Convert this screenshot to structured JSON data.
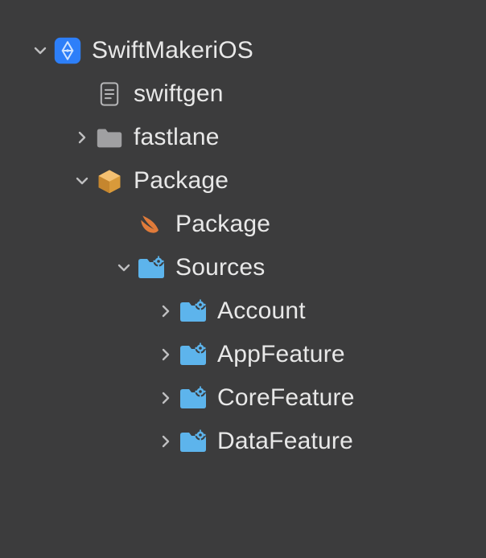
{
  "tree": {
    "project": "SwiftMakeriOS",
    "items": [
      {
        "label": "swiftgen"
      },
      {
        "label": "fastlane"
      },
      {
        "label": "Package"
      },
      {
        "label": "Package"
      },
      {
        "label": "Sources"
      },
      {
        "label": "Account"
      },
      {
        "label": "AppFeature"
      },
      {
        "label": "CoreFeature"
      },
      {
        "label": "DataFeature"
      }
    ]
  },
  "colors": {
    "background": "#3c3c3d",
    "text": "#e8e8e8",
    "chevron": "#bfbfc0",
    "appIcon": "#2d7ff9",
    "folderGray": "#a0a0a2",
    "packageBox": "#d99a3a",
    "swift": "#e07b3a",
    "folderBlue": "#5db4ec"
  }
}
